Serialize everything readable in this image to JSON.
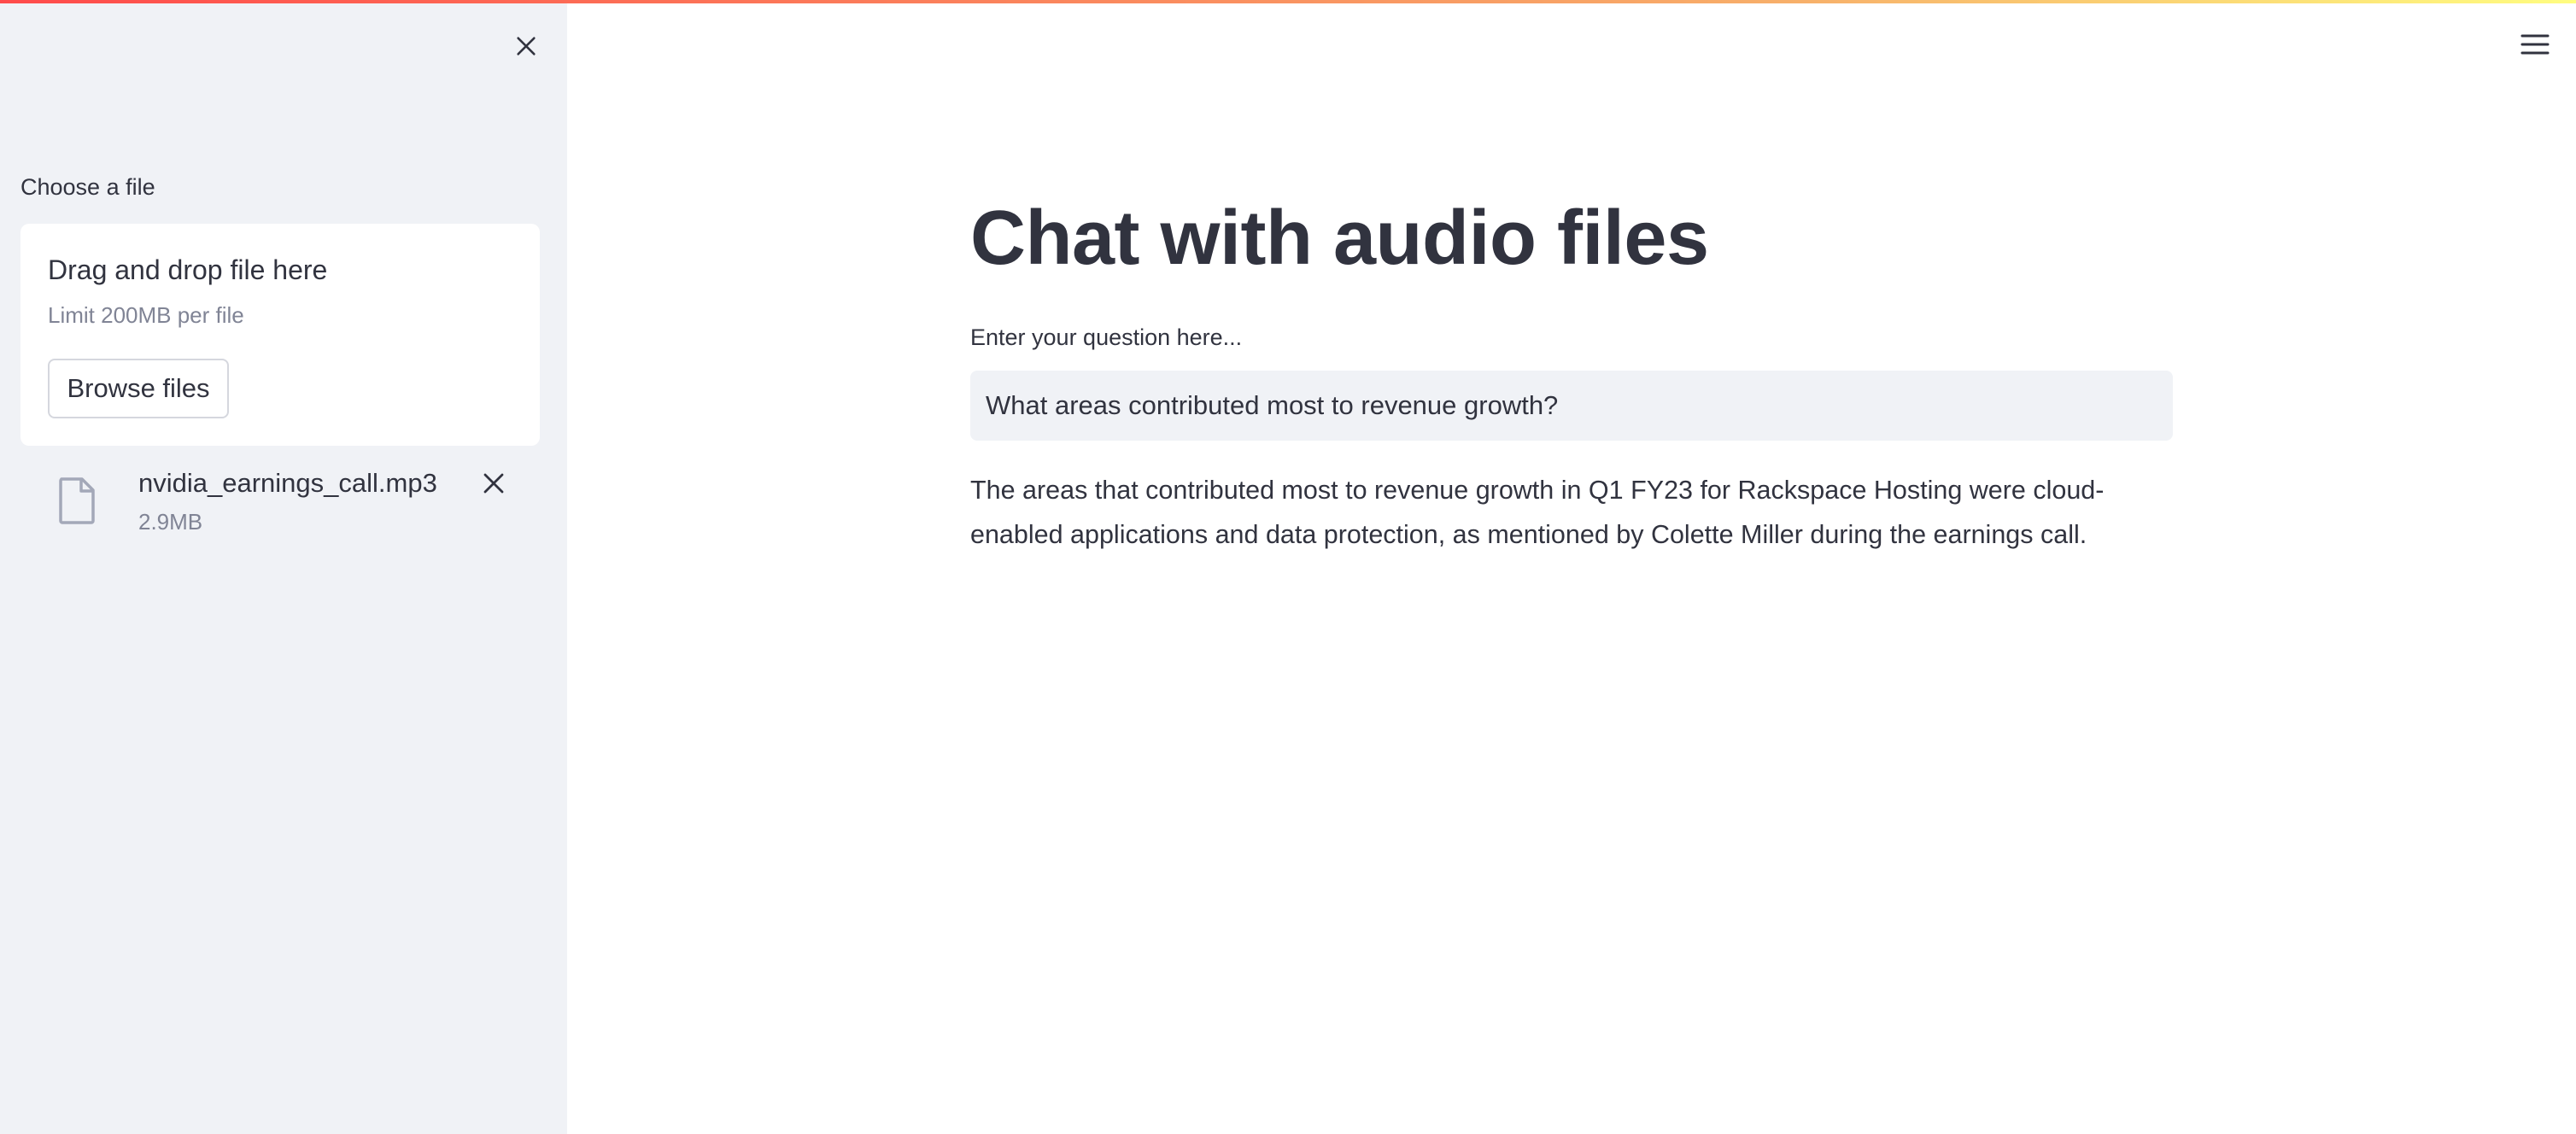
{
  "sidebar": {
    "uploader": {
      "label": "Choose a file",
      "dropzone_title": "Drag and drop file here",
      "dropzone_limit": "Limit 200MB per file",
      "browse_label": "Browse files"
    },
    "uploaded_file": {
      "name": "nvidia_earnings_call.mp3",
      "size": "2.9MB",
      "icon": "file-icon"
    }
  },
  "main": {
    "title": "Chat with audio files",
    "question": {
      "label": "Enter your question here...",
      "value": "What areas contributed most to revenue growth?"
    },
    "answer": "The areas that contributed most to revenue growth in Q1 FY23 for Rackspace Hosting were cloud-enabled applications and data protection, as mentioned by Colette Miller during the earnings call."
  },
  "icons": {
    "sidebar_close": "close-icon",
    "file_remove": "close-icon",
    "main_menu": "hamburger-menu-icon"
  },
  "colors": {
    "sidebar_bg": "#f0f2f6",
    "text": "#31333f",
    "muted_text": "#808495",
    "input_bg": "#f0f2f6",
    "accent_gradient_start": "#ff4b4b",
    "accent_gradient_end": "#fffd80"
  }
}
